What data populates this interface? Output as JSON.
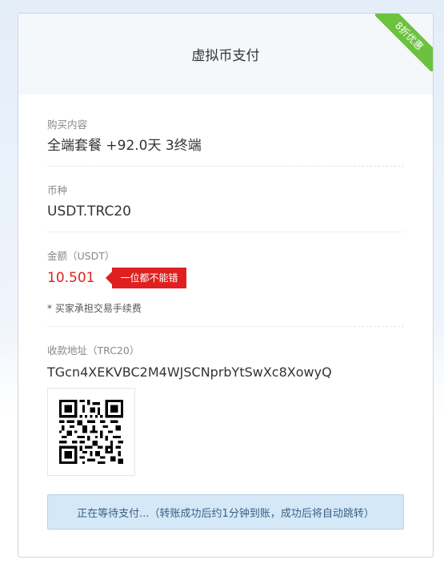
{
  "header": {
    "title": "虚拟币支付",
    "badge": "8折优惠"
  },
  "purchase": {
    "label": "购买内容",
    "value": "全端套餐 +92.0天 3终端"
  },
  "currency": {
    "label": "币种",
    "value": "USDT.TRC20"
  },
  "amount": {
    "label": "金额（USDT）",
    "value": "10.501",
    "tag": "一位都不能错",
    "note": "* 买家承担交易手续费"
  },
  "address": {
    "label": "收款地址（TRC20）",
    "value": "TGcn4XEKVBC2M4WJSCNprbYtSwXc8XowyQ"
  },
  "qr": {
    "icon": "qr-code-icon"
  },
  "status": {
    "text": "正在等待支付...（转账成功后约1分钟到账，成功后将自动跳转）"
  },
  "colors": {
    "accent_red": "#e02020",
    "badge_green": "#6cc23f",
    "status_bg": "#d4e8f8"
  }
}
